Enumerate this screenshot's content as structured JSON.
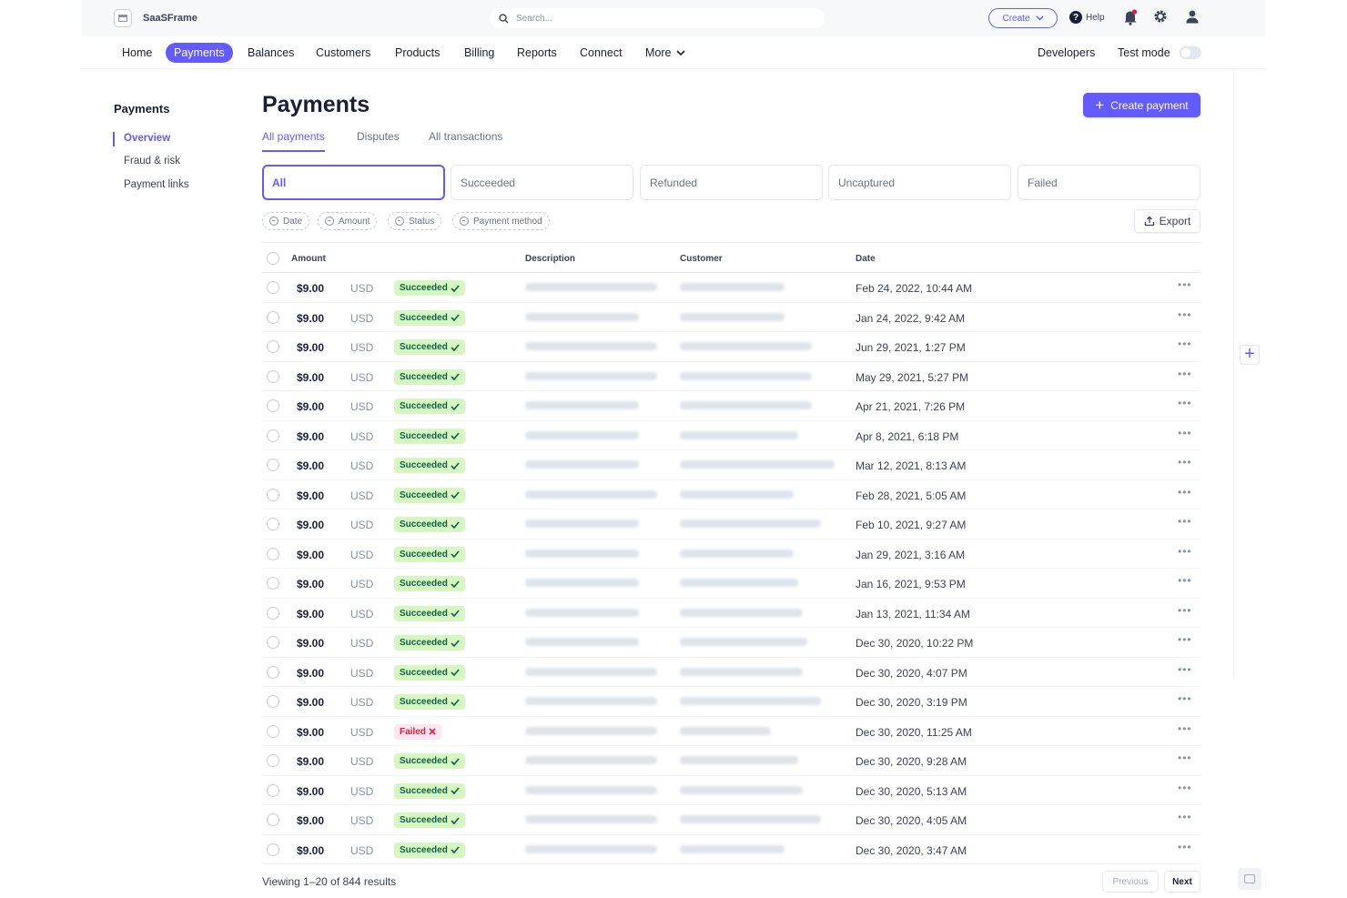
{
  "app": {
    "name": "SaaSFrame",
    "search_placeholder": "Search..."
  },
  "topbar": {
    "create_label": "Create",
    "help_label": "Help"
  },
  "nav": {
    "items": [
      "Home",
      "Payments",
      "Balances",
      "Customers",
      "Products",
      "Billing",
      "Reports",
      "Connect",
      "More"
    ],
    "active": "Payments",
    "developers": "Developers",
    "test_mode": "Test mode"
  },
  "sidebar": {
    "title": "Payments",
    "items": [
      "Overview",
      "Fraud & risk",
      "Payment links"
    ],
    "active": "Overview"
  },
  "page": {
    "title": "Payments",
    "create_button": "Create payment"
  },
  "tabs": [
    "All payments",
    "Disputes",
    "All transactions"
  ],
  "status_cards": [
    "All",
    "Succeeded",
    "Refunded",
    "Uncaptured",
    "Failed"
  ],
  "filters": [
    "Date",
    "Amount",
    "Status",
    "Payment method"
  ],
  "export_label": "Export",
  "table": {
    "columns": [
      "Amount",
      "Description",
      "Customer",
      "Date"
    ],
    "rows": [
      {
        "amount": "$9.00",
        "currency": "USD",
        "status": "Succeeded",
        "date": "Feb 24, 2022, 10:44 AM"
      },
      {
        "amount": "$9.00",
        "currency": "USD",
        "status": "Succeeded",
        "date": "Jan 24, 2022, 9:42 AM"
      },
      {
        "amount": "$9.00",
        "currency": "USD",
        "status": "Succeeded",
        "date": "Jun 29, 2021, 1:27 PM"
      },
      {
        "amount": "$9.00",
        "currency": "USD",
        "status": "Succeeded",
        "date": "May 29, 2021, 5:27 PM"
      },
      {
        "amount": "$9.00",
        "currency": "USD",
        "status": "Succeeded",
        "date": "Apr 21, 2021, 7:26 PM"
      },
      {
        "amount": "$9.00",
        "currency": "USD",
        "status": "Succeeded",
        "date": "Apr 8, 2021, 6:18 PM"
      },
      {
        "amount": "$9.00",
        "currency": "USD",
        "status": "Succeeded",
        "date": "Mar 12, 2021, 8:13 AM"
      },
      {
        "amount": "$9.00",
        "currency": "USD",
        "status": "Succeeded",
        "date": "Feb 28, 2021, 5:05 AM"
      },
      {
        "amount": "$9.00",
        "currency": "USD",
        "status": "Succeeded",
        "date": "Feb 10, 2021, 9:27 AM"
      },
      {
        "amount": "$9.00",
        "currency": "USD",
        "status": "Succeeded",
        "date": "Jan 29, 2021, 3:16 AM"
      },
      {
        "amount": "$9.00",
        "currency": "USD",
        "status": "Succeeded",
        "date": "Jan 16, 2021, 9:53 PM"
      },
      {
        "amount": "$9.00",
        "currency": "USD",
        "status": "Succeeded",
        "date": "Jan 13, 2021, 11:34 AM"
      },
      {
        "amount": "$9.00",
        "currency": "USD",
        "status": "Succeeded",
        "date": "Dec 30, 2020, 10:22 PM"
      },
      {
        "amount": "$9.00",
        "currency": "USD",
        "status": "Succeeded",
        "date": "Dec 30, 2020, 4:07 PM"
      },
      {
        "amount": "$9.00",
        "currency": "USD",
        "status": "Succeeded",
        "date": "Dec 30, 2020, 3:19 PM"
      },
      {
        "amount": "$9.00",
        "currency": "USD",
        "status": "Failed",
        "date": "Dec 30, 2020, 11:25 AM"
      },
      {
        "amount": "$9.00",
        "currency": "USD",
        "status": "Succeeded",
        "date": "Dec 30, 2020, 9:28 AM"
      },
      {
        "amount": "$9.00",
        "currency": "USD",
        "status": "Succeeded",
        "date": "Dec 30, 2020, 5:13 AM"
      },
      {
        "amount": "$9.00",
        "currency": "USD",
        "status": "Succeeded",
        "date": "Dec 30, 2020, 4:05 AM"
      },
      {
        "amount": "$9.00",
        "currency": "USD",
        "status": "Succeeded",
        "date": "Dec 30, 2020, 3:47 AM"
      }
    ]
  },
  "footer": {
    "viewing": "Viewing 1–20 of 844 results",
    "previous": "Previous",
    "next": "Next"
  },
  "colors": {
    "accent": "#635bff",
    "success_bg": "#d7f7c2",
    "success_text": "#0e6245",
    "fail_bg": "#ffe7f2",
    "fail_text": "#df1b41"
  },
  "icons": [
    "app-icon",
    "search-icon",
    "chevron-down-icon",
    "help-icon",
    "bell-icon",
    "gear-icon",
    "user-icon",
    "plus-icon",
    "export-icon",
    "check-icon",
    "x-icon",
    "more-icon"
  ]
}
